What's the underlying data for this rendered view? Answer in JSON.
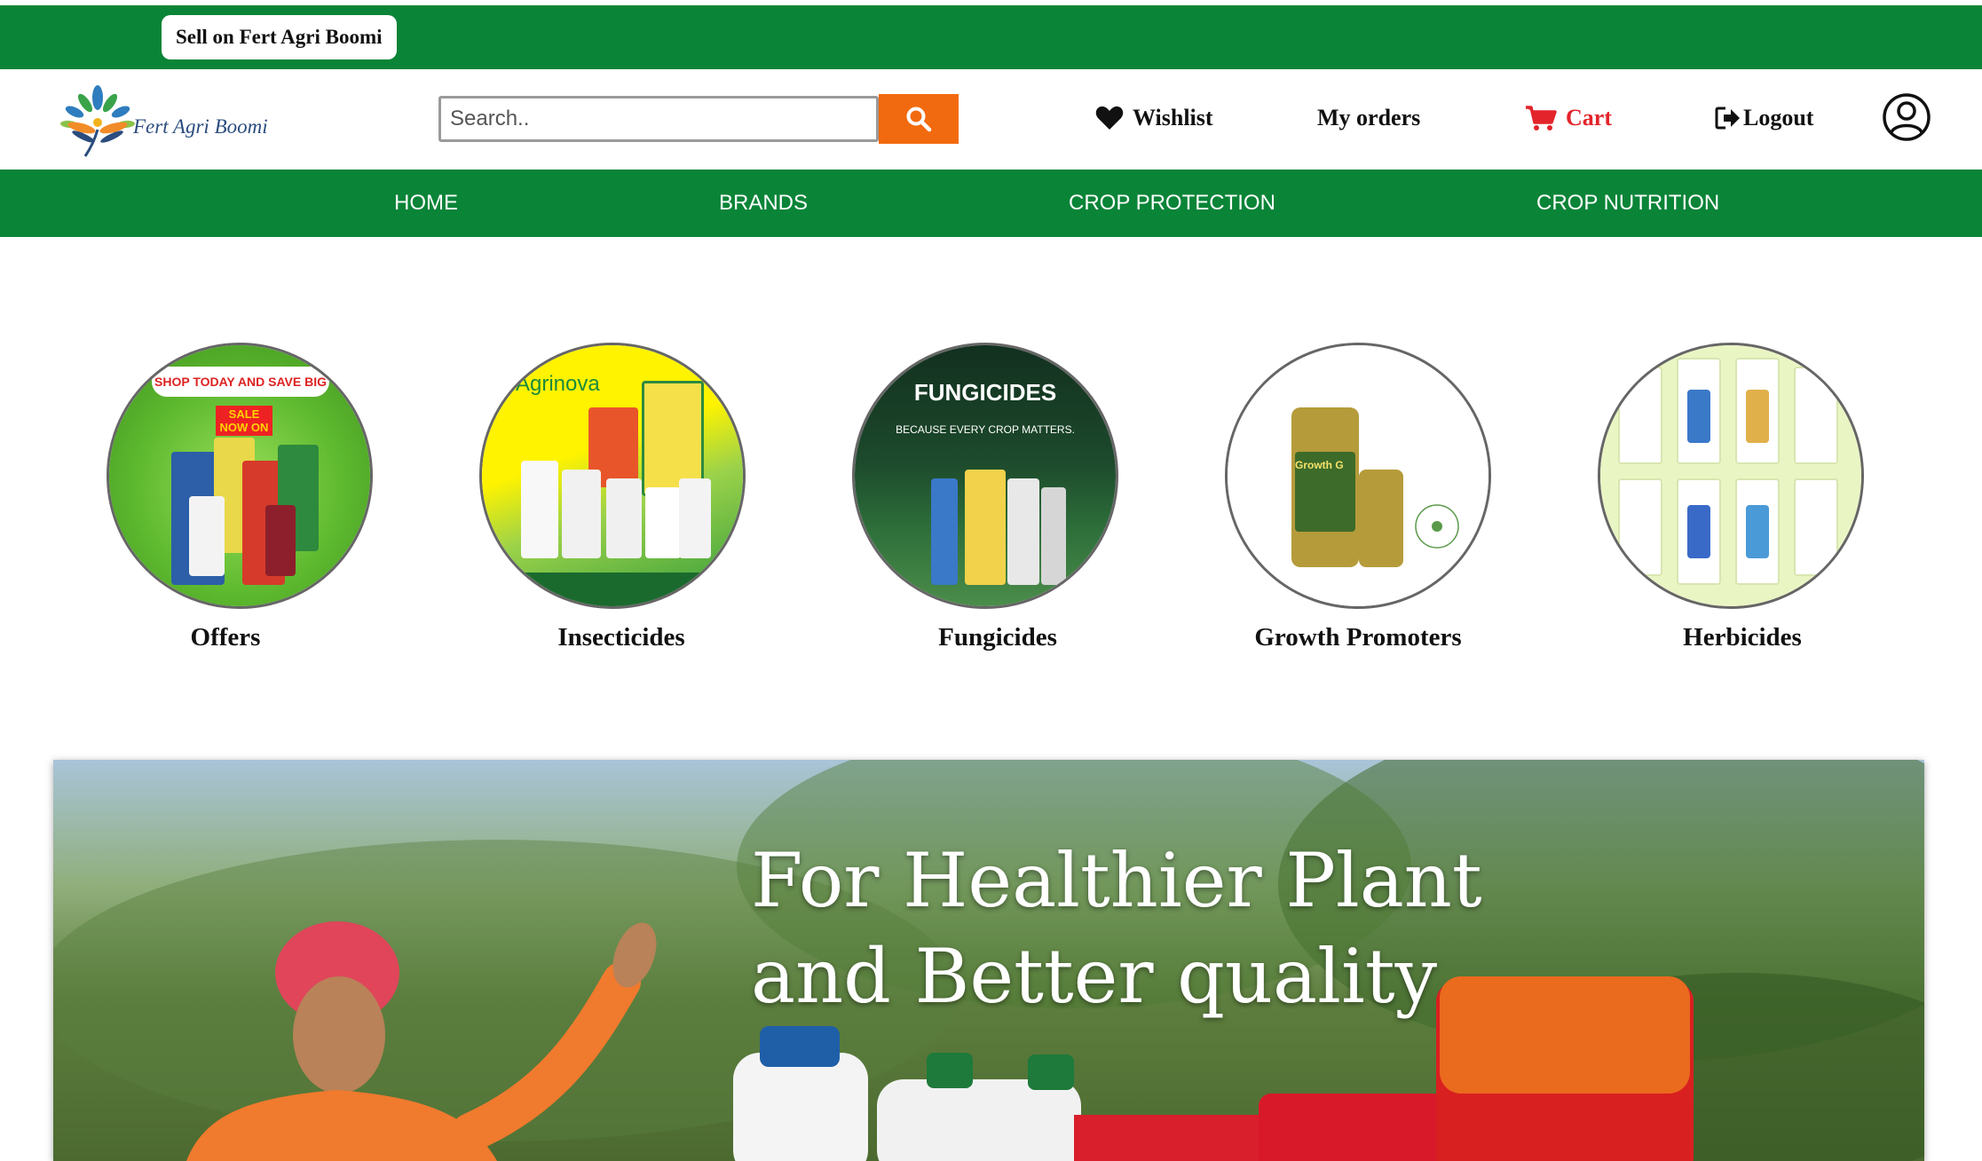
{
  "topbar": {
    "sell_label": "Sell on Fert Agri Boomi"
  },
  "header": {
    "logo_text": "Fert Agri Boomi",
    "search": {
      "placeholder": "Search..",
      "value": ""
    },
    "wishlist_label": "Wishlist",
    "orders_label": "My orders",
    "cart_label": "Cart",
    "logout_label": "Logout"
  },
  "nav": {
    "items": [
      {
        "label": "HOME"
      },
      {
        "label": "BRANDS"
      },
      {
        "label": "CROP PROTECTION"
      },
      {
        "label": "CROP NUTRITION"
      }
    ]
  },
  "categories": [
    {
      "label": "Offers",
      "promo_text": "SHOP TODAY AND SAVE BIG",
      "sale_text": "SALE NOW ON"
    },
    {
      "label": "Insecticides",
      "brand_text": "Agrinova"
    },
    {
      "label": "Fungicides",
      "heading_text": "FUNGICIDES",
      "sub_text": "BECAUSE EVERY CROP MATTERS."
    },
    {
      "label": "Growth Promoters",
      "product_text": "Growth G"
    },
    {
      "label": "Herbicides"
    }
  ],
  "hero": {
    "line1": "For Healthier Plant",
    "line2": "and Better quality"
  },
  "colors": {
    "brand_green": "#0a8437",
    "search_orange": "#f26a0f",
    "cart_red": "#e3242b"
  }
}
